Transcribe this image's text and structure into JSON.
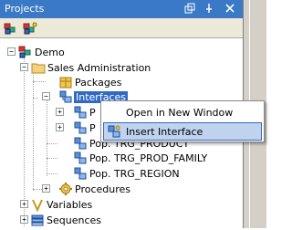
{
  "panel": {
    "title": "Projects",
    "buttons": [
      "restore",
      "pin",
      "close"
    ]
  },
  "toolbar": {
    "icons": [
      "new-project-icon",
      "project-settings-icon"
    ]
  },
  "tree": {
    "items": [
      {
        "label": "Demo",
        "icon": "project-icon"
      },
      {
        "label": "Sales Administration",
        "icon": "folder-icon"
      },
      {
        "label": "Packages",
        "icon": "package-icon"
      },
      {
        "label": "Interfaces",
        "icon": "interface-folder-icon"
      },
      {
        "label": "P",
        "icon": "interface-icon"
      },
      {
        "label": "P",
        "icon": "interface-icon"
      },
      {
        "label": "Pop. TRG_PRODUCT",
        "icon": "interface-icon"
      },
      {
        "label": "Pop. TRG_PROD_FAMILY",
        "icon": "interface-icon"
      },
      {
        "label": "Pop. TRG_REGION",
        "icon": "interface-icon"
      },
      {
        "label": "Procedures",
        "icon": "procedure-icon"
      },
      {
        "label": "Variables",
        "icon": "variable-icon"
      },
      {
        "label": "Sequences",
        "icon": "sequence-icon"
      }
    ]
  },
  "context_menu": {
    "items": [
      {
        "label": "Open in New Window",
        "highlighted": false
      },
      {
        "label": "Insert Interface",
        "highlighted": true,
        "icon": "insert-interface-icon"
      }
    ]
  },
  "colors": {
    "titlebar": "#3a79c6",
    "selection": "#316ac5",
    "menu_highlight": "#c1d2ee"
  }
}
